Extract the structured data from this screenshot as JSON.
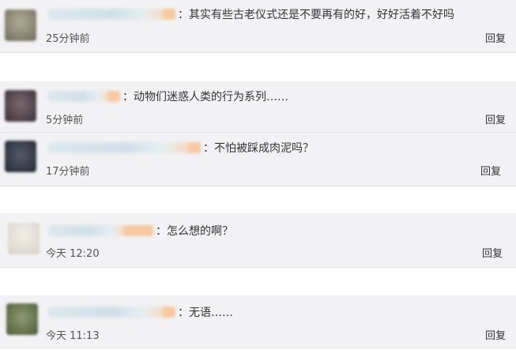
{
  "comments": [
    {
      "text": "其实有些古老仪式还是不要再有的好，好好活着不好吗",
      "time": "25分钟前",
      "reply_label": "回复",
      "avatar_color": "#8a8a7a"
    },
    {
      "text": "动物们迷惑人类的行为系列……",
      "time": "5分钟前",
      "reply_label": "回复",
      "avatar_color": "#5a4f55"
    },
    {
      "text": "不怕被踩成肉泥吗？",
      "time": "17分钟前",
      "reply_label": "回复",
      "avatar_color": "#3e4250"
    },
    {
      "text": "怎么想的啊？",
      "time": "今天 12:20",
      "reply_label": "回复",
      "avatar_color": "#e0ddd4"
    },
    {
      "text": "无语……",
      "time": "今天 11:13",
      "reply_label": "回复",
      "avatar_color": "#6f7a55"
    }
  ]
}
